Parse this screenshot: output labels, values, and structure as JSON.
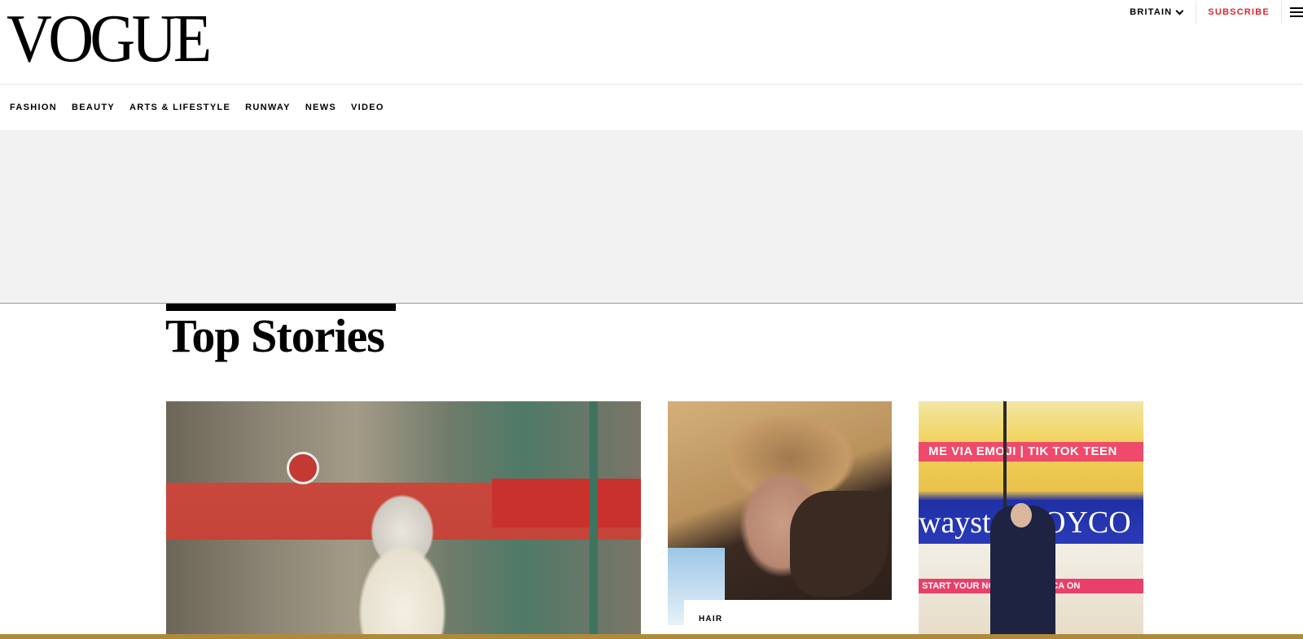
{
  "masthead": {
    "logo": "VOGUE",
    "edition": "BRITAIN",
    "subscribe": "SUBSCRIBE"
  },
  "nav": {
    "items": [
      "FASHION",
      "BEAUTY",
      "ARTS & LIFESTYLE",
      "RUNWAY",
      "NEWS",
      "VIDEO"
    ]
  },
  "section": {
    "title": "Top Stories"
  },
  "cards": [
    {
      "category": ""
    },
    {
      "category": "HAIR"
    },
    {
      "category": "",
      "screen_text_1": "ME VIA EMOJI | TIK TOK TEEN",
      "screen_text_2": "waystar ROYCO",
      "screen_text_3": "START YOUR   NG WITH   AMERICA  ON"
    }
  ],
  "colors": {
    "brand_red": "#e2232d",
    "ad_background": "#f2f2f2"
  },
  "icons": {
    "edition": "chevron-down-icon",
    "menu": "hamburger-menu-icon"
  }
}
